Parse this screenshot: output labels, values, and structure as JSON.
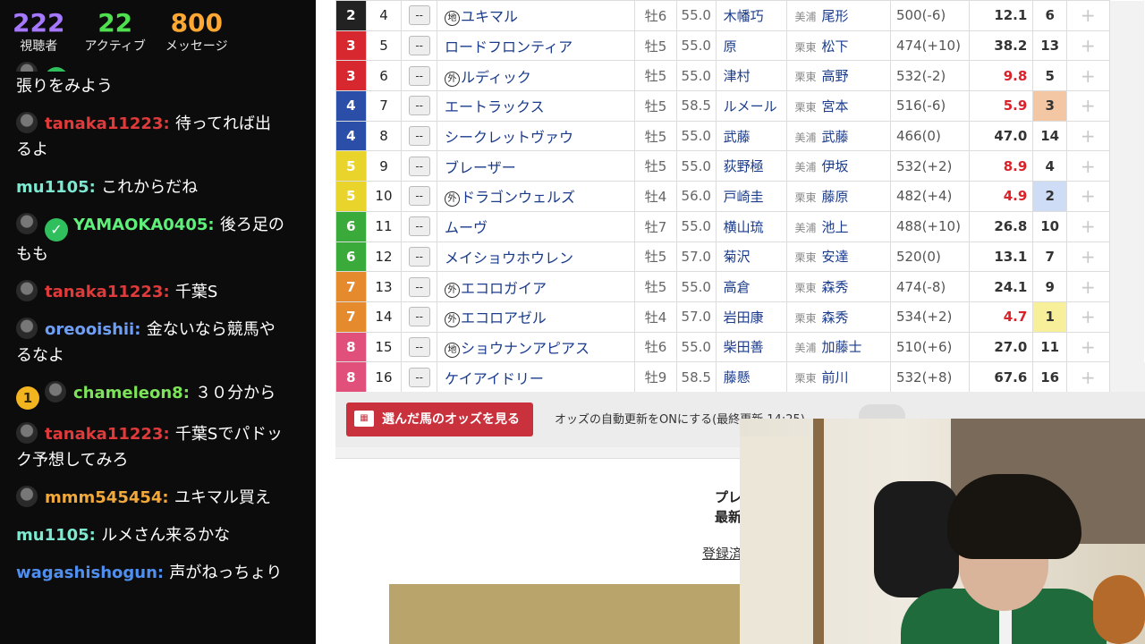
{
  "stats": [
    {
      "value": "222",
      "label": "視聴者",
      "color": "#a678ff"
    },
    {
      "value": "22",
      "label": "アクティブ",
      "color": "#4fe04f"
    },
    {
      "value": "800",
      "label": "メッセージ",
      "color": "#ffa733"
    }
  ],
  "chat": {
    "partial_top_text": "張りをみよう",
    "messages": [
      {
        "user": "tanaka11223",
        "color": "#e03a3a",
        "text": "待ってれば出るよ",
        "avatar": true,
        "verified": false,
        "badge": ""
      },
      {
        "user": "mu1105",
        "color": "#7ee8d0",
        "text": "これからだね",
        "avatar": false,
        "verified": false,
        "badge": ""
      },
      {
        "user": "YAMAOKA0405",
        "color": "#5ff07a",
        "text": "後ろ足のもも",
        "avatar": true,
        "verified": true,
        "badge": ""
      },
      {
        "user": "tanaka11223",
        "color": "#e03a3a",
        "text": "千葉S",
        "avatar": true,
        "verified": false,
        "badge": ""
      },
      {
        "user": "oreooishii",
        "color": "#6f9ef5",
        "text": "金ないなら競馬やるなよ",
        "avatar": true,
        "verified": false,
        "badge": ""
      },
      {
        "user": "chameleon8",
        "color": "#7de35a",
        "text": "３０分から",
        "avatar": true,
        "verified": false,
        "badge": "1"
      },
      {
        "user": "tanaka11223",
        "color": "#e03a3a",
        "text": "千葉Sでパドック予想してみろ",
        "avatar": true,
        "verified": false,
        "badge": ""
      },
      {
        "user": "mmm545454",
        "color": "#f2a93b",
        "text": "ユキマル買え",
        "avatar": true,
        "verified": false,
        "badge": ""
      },
      {
        "user": "mu1105",
        "color": "#7ee8d0",
        "text": "ルメさん来るかな",
        "avatar": false,
        "verified": false,
        "badge": ""
      },
      {
        "user": "wagashishogun",
        "color": "#4f8ff0",
        "text": "声がねっちょり",
        "avatar": false,
        "verified": false,
        "badge": ""
      }
    ]
  },
  "table": {
    "mark_placeholder": "--",
    "fav_icon": "+",
    "rows": [
      {
        "waku": "2",
        "waku_color": "#222222",
        "num": "4",
        "prefix": "地",
        "name": "ユキマル",
        "sex": "牡6",
        "kin": "55.0",
        "jockey": "木幡巧",
        "area": "美浦",
        "trainer": "尾形",
        "weight": "500(-6)",
        "odds": "12.1",
        "odds_hot": false,
        "pop": "6",
        "pop_bg": ""
      },
      {
        "waku": "3",
        "waku_color": "#d7282f",
        "num": "5",
        "prefix": "",
        "name": "ロードフロンティア",
        "sex": "牡5",
        "kin": "55.0",
        "jockey": "原",
        "area": "栗東",
        "trainer": "松下",
        "weight": "474(+10)",
        "odds": "38.2",
        "odds_hot": false,
        "pop": "13",
        "pop_bg": ""
      },
      {
        "waku": "3",
        "waku_color": "#d7282f",
        "num": "6",
        "prefix": "外",
        "name": "ルディック",
        "sex": "牡5",
        "kin": "55.0",
        "jockey": "津村",
        "area": "栗東",
        "trainer": "高野",
        "weight": "532(-2)",
        "odds": "9.8",
        "odds_hot": true,
        "pop": "5",
        "pop_bg": ""
      },
      {
        "waku": "4",
        "waku_color": "#2b4fa8",
        "num": "7",
        "prefix": "",
        "name": "エートラックス",
        "sex": "牡5",
        "kin": "58.5",
        "jockey": "ルメール",
        "area": "栗東",
        "trainer": "宮本",
        "weight": "516(-6)",
        "odds": "5.9",
        "odds_hot": true,
        "pop": "3",
        "pop_bg": "#f3c7a3"
      },
      {
        "waku": "4",
        "waku_color": "#2b4fa8",
        "num": "8",
        "prefix": "",
        "name": "シークレットヴァウ",
        "sex": "牡5",
        "kin": "55.0",
        "jockey": "武藤",
        "area": "美浦",
        "trainer": "武藤",
        "weight": "466(0)",
        "odds": "47.0",
        "odds_hot": false,
        "pop": "14",
        "pop_bg": ""
      },
      {
        "waku": "5",
        "waku_color": "#e8d42a",
        "num": "9",
        "prefix": "",
        "name": "ブレーザー",
        "sex": "牡5",
        "kin": "55.0",
        "jockey": "荻野極",
        "area": "美浦",
        "trainer": "伊坂",
        "weight": "532(+2)",
        "odds": "8.9",
        "odds_hot": true,
        "pop": "4",
        "pop_bg": ""
      },
      {
        "waku": "5",
        "waku_color": "#e8d42a",
        "num": "10",
        "prefix": "外",
        "name": "ドラゴンウェルズ",
        "sex": "牡4",
        "kin": "56.0",
        "jockey": "戸崎圭",
        "area": "栗東",
        "trainer": "藤原",
        "weight": "482(+4)",
        "odds": "4.9",
        "odds_hot": true,
        "pop": "2",
        "pop_bg": "#cfdcf5"
      },
      {
        "waku": "6",
        "waku_color": "#3aaa3a",
        "num": "11",
        "prefix": "",
        "name": "ムーヴ",
        "sex": "牡7",
        "kin": "55.0",
        "jockey": "横山琉",
        "area": "美浦",
        "trainer": "池上",
        "weight": "488(+10)",
        "odds": "26.8",
        "odds_hot": false,
        "pop": "10",
        "pop_bg": ""
      },
      {
        "waku": "6",
        "waku_color": "#3aaa3a",
        "num": "12",
        "prefix": "",
        "name": "メイショウホウレン",
        "sex": "牡5",
        "kin": "57.0",
        "jockey": "菊沢",
        "area": "栗東",
        "trainer": "安達",
        "weight": "520(0)",
        "odds": "13.1",
        "odds_hot": false,
        "pop": "7",
        "pop_bg": ""
      },
      {
        "waku": "7",
        "waku_color": "#e68a2e",
        "num": "13",
        "prefix": "外",
        "name": "エコロガイア",
        "sex": "牡5",
        "kin": "55.0",
        "jockey": "高倉",
        "area": "栗東",
        "trainer": "森秀",
        "weight": "474(-8)",
        "odds": "24.1",
        "odds_hot": false,
        "pop": "9",
        "pop_bg": ""
      },
      {
        "waku": "7",
        "waku_color": "#e68a2e",
        "num": "14",
        "prefix": "外",
        "name": "エコロアゼル",
        "sex": "牡4",
        "kin": "57.0",
        "jockey": "岩田康",
        "area": "栗東",
        "trainer": "森秀",
        "weight": "534(+2)",
        "odds": "4.7",
        "odds_hot": true,
        "pop": "1",
        "pop_bg": "#f7ef9a"
      },
      {
        "waku": "8",
        "waku_color": "#e0507a",
        "num": "15",
        "prefix": "地",
        "name": "ショウナンアピアス",
        "sex": "牡6",
        "kin": "55.0",
        "jockey": "柴田善",
        "area": "美浦",
        "trainer": "加藤士",
        "weight": "510(+6)",
        "odds": "27.0",
        "odds_hot": false,
        "pop": "11",
        "pop_bg": ""
      },
      {
        "waku": "8",
        "waku_color": "#e0507a",
        "num": "16",
        "prefix": "",
        "name": "ケイアイドリー",
        "sex": "牡9",
        "kin": "58.5",
        "jockey": "藤懸",
        "area": "栗東",
        "trainer": "前川",
        "weight": "532(+8)",
        "odds": "67.6",
        "odds_hot": false,
        "pop": "16",
        "pop_bg": ""
      }
    ]
  },
  "odds_button": {
    "label": "選んだ馬のオッズを見る",
    "icon": "odds-icon"
  },
  "auto_update_text": "オッズの自動更新をONにする(最終更新 14:25)",
  "promo": {
    "line1": "プレ",
    "line2": "最新",
    "link": "登録済"
  }
}
